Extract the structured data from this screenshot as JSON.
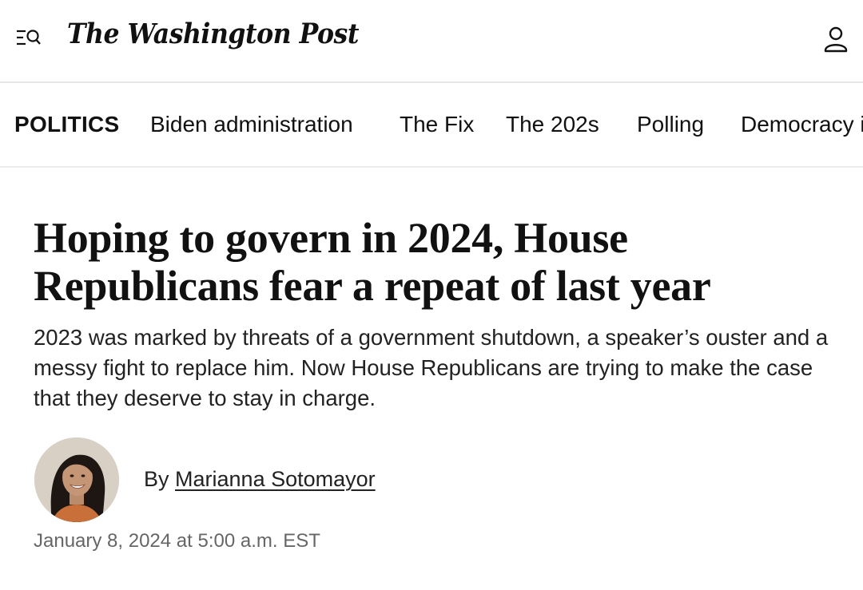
{
  "header": {
    "masthead": "The Washington Post",
    "menu_icon": "menu-search-icon",
    "account_icon": "account-icon"
  },
  "nav": {
    "section_label": "POLITICS",
    "items": [
      "Biden administration",
      "The Fix",
      "The 202s",
      "Polling",
      "Democracy i"
    ]
  },
  "article": {
    "headline": "Hoping to govern in 2024, House Republicans fear a repeat of last year",
    "dek": "2023 was marked by threats of a government shutdown, a speaker’s ouster and a messy fight to replace him. Now House Republicans are trying to make the case that they deserve to stay in charge.",
    "byline_prefix": "By",
    "author": "Marianna Sotomayor",
    "timestamp": "January 8, 2024 at 5:00 a.m. EST"
  },
  "colors": {
    "text": "#111111",
    "muted": "#666666",
    "divider": "#e6e6e6"
  }
}
